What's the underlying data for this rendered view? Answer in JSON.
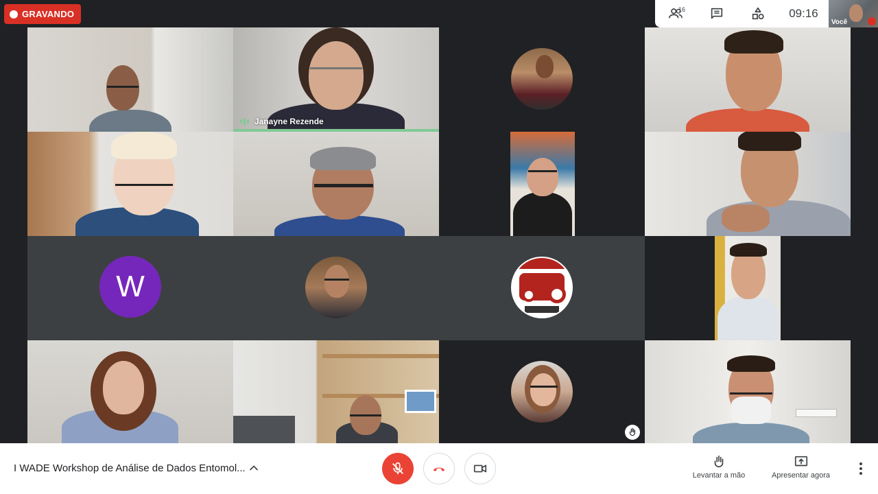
{
  "recording": {
    "label": "GRAVANDO",
    "color": "#d93025"
  },
  "top_panel": {
    "people_icon": "people-icon",
    "participant_count": "16",
    "chat_icon": "chat-icon",
    "activities_icon": "activities-icon",
    "time": "09:16",
    "self_label": "Você"
  },
  "tiles": {
    "speaker_name": "Janayne Rezende",
    "w_initial": "W",
    "speaking_color": "#81c995"
  },
  "bottom_bar": {
    "meeting_title": "I WADE Workshop de Análise de Dados Entomol...",
    "mic_icon": "mic-off-icon",
    "end_call_icon": "end-call-icon",
    "camera_icon": "camera-icon",
    "raise_hand_label": "Levantar a mão",
    "present_label": "Apresentar agora",
    "more_icon": "more-vert-icon"
  }
}
